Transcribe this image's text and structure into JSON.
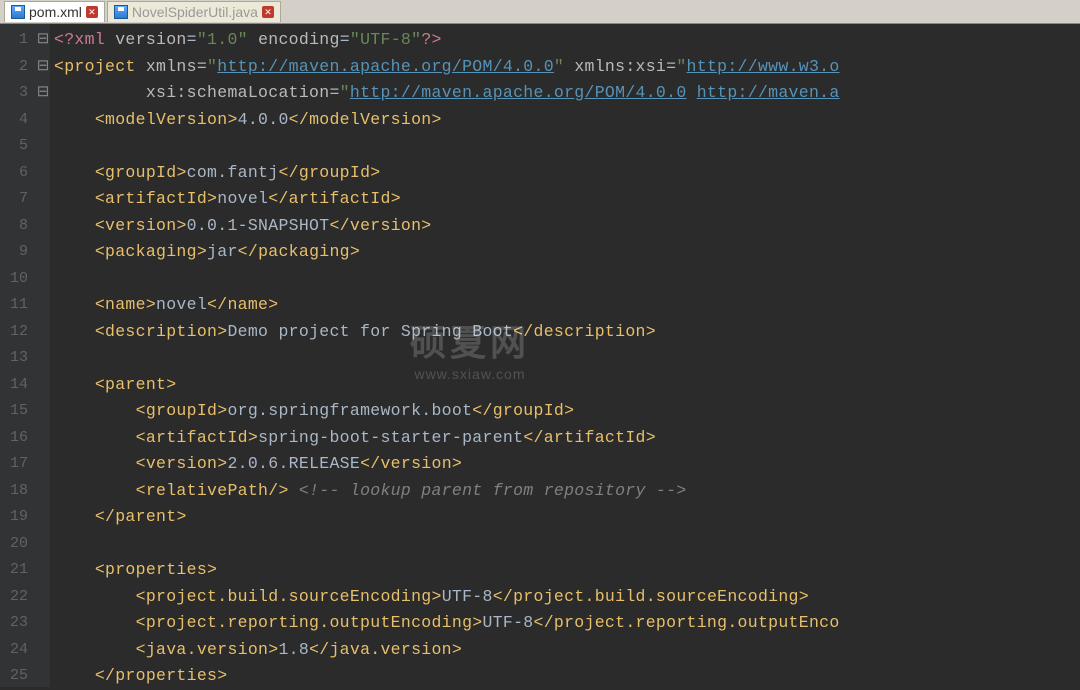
{
  "tabs": [
    {
      "name": "pom.xml",
      "active": true
    },
    {
      "name": "NovelSpiderUtil.java",
      "active": false
    }
  ],
  "watermark": {
    "title": "硕夏网",
    "url": "www.sxiaw.com"
  },
  "code": {
    "xml_decl_version": "\"1.0\"",
    "xml_decl_encoding": "\"UTF-8\"",
    "xmlns": "http://maven.apache.org/POM/4.0.0",
    "xmlns_xsi": "http://www.w3.o",
    "schema_loc_1": "http://maven.apache.org/POM/4.0.0",
    "schema_loc_2": "http://maven.a",
    "modelVersion": "4.0.0",
    "groupId": "com.fantj",
    "artifactId": "novel",
    "version": "0.0.1-SNAPSHOT",
    "packaging": "jar",
    "name": "novel",
    "description": "Demo project for Spring Boot",
    "parent": {
      "groupId": "org.springframework.boot",
      "artifactId": "spring-boot-starter-parent",
      "version": "2.0.6.RELEASE",
      "comment": "<!-- lookup parent from repository -->"
    },
    "properties": {
      "sourceEncoding": "UTF-8",
      "outputEncoding": "UTF-8",
      "javaVersion": "1.8"
    },
    "tags": {
      "project": "project",
      "modelVersion": "modelVersion",
      "groupId": "groupId",
      "artifactId": "artifactId",
      "version": "version",
      "packaging": "packaging",
      "name": "name",
      "description": "description",
      "parent": "parent",
      "relativePath": "relativePath",
      "properties": "properties",
      "sourceEnc": "project.build.sourceEncoding",
      "outputEnc": "project.reporting.outputEncoding",
      "outputEncShort": "project.reporting.outputEnco",
      "javaVer": "java.version"
    },
    "attrs": {
      "xmlns": "xmlns",
      "xmlns_xsi": "xmlns:xsi",
      "schemaLocation": "xsi:schemaLocation",
      "version": "version",
      "encoding": "encoding"
    },
    "xml_pi": "xml"
  },
  "lines": [
    "1",
    "2",
    "3",
    "4",
    "5",
    "6",
    "7",
    "8",
    "9",
    "10",
    "11",
    "12",
    "13",
    "14",
    "15",
    "16",
    "17",
    "18",
    "19",
    "20",
    "21",
    "22",
    "23",
    "24",
    "25"
  ]
}
